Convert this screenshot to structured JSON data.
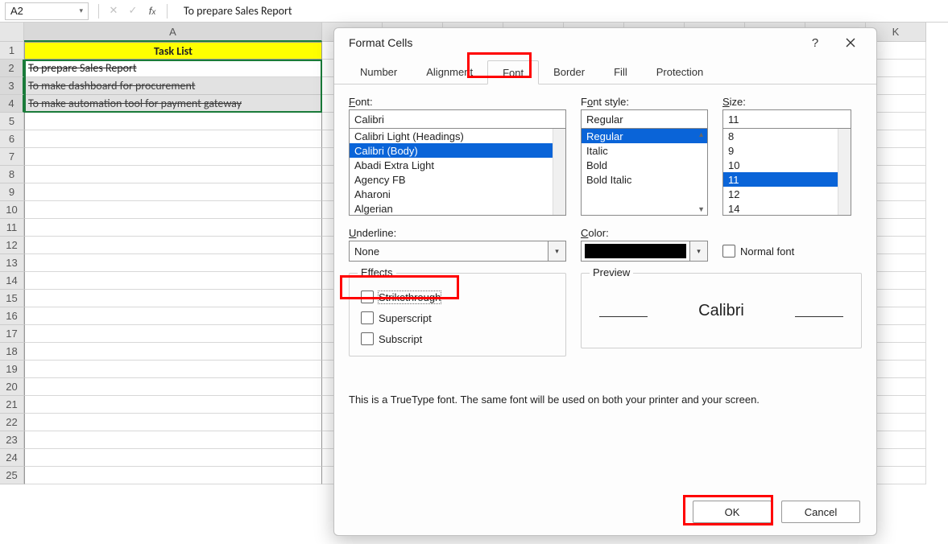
{
  "namebox": "A2",
  "formula": "To prepare Sales Report",
  "colA_header": "A",
  "colK_header": "K",
  "rows": [
    "1",
    "2",
    "3",
    "4",
    "5",
    "6",
    "7",
    "8",
    "9",
    "10",
    "11",
    "12",
    "13",
    "14",
    "15",
    "16",
    "17",
    "18",
    "19",
    "20",
    "21",
    "22",
    "23",
    "24",
    "25"
  ],
  "tasks": {
    "title": "Task List",
    "r2": "To prepare Sales Report",
    "r3": "To make dashboard for procurement",
    "r4": "To make automation tool for payment gateway"
  },
  "dialog": {
    "title": "Format Cells",
    "tabs": {
      "number": "Number",
      "alignment": "Alignment",
      "font": "Font",
      "border": "Border",
      "fill": "Fill",
      "protection": "Protection"
    },
    "font": {
      "label": "Font:",
      "value": "Calibri",
      "list": [
        "Calibri Light (Headings)",
        "Calibri (Body)",
        "Abadi Extra Light",
        "Agency FB",
        "Aharoni",
        "Algerian"
      ]
    },
    "style": {
      "label": "Font style:",
      "value": "Regular",
      "list": [
        "Regular",
        "Italic",
        "Bold",
        "Bold Italic"
      ]
    },
    "size": {
      "label": "Size:",
      "value": "11",
      "list": [
        "8",
        "9",
        "10",
        "11",
        "12",
        "14"
      ]
    },
    "underline": {
      "label": "Underline:",
      "value": "None"
    },
    "color": {
      "label": "Color:"
    },
    "normalfont": "Normal font",
    "effects": {
      "legend": "Effects",
      "strike": "Strikethrough",
      "sup": "Superscript",
      "sub": "Subscript"
    },
    "preview": {
      "legend": "Preview",
      "sample": "Calibri"
    },
    "note": "This is a TrueType font.  The same font will be used on both your printer and your screen.",
    "ok": "OK",
    "cancel": "Cancel"
  }
}
